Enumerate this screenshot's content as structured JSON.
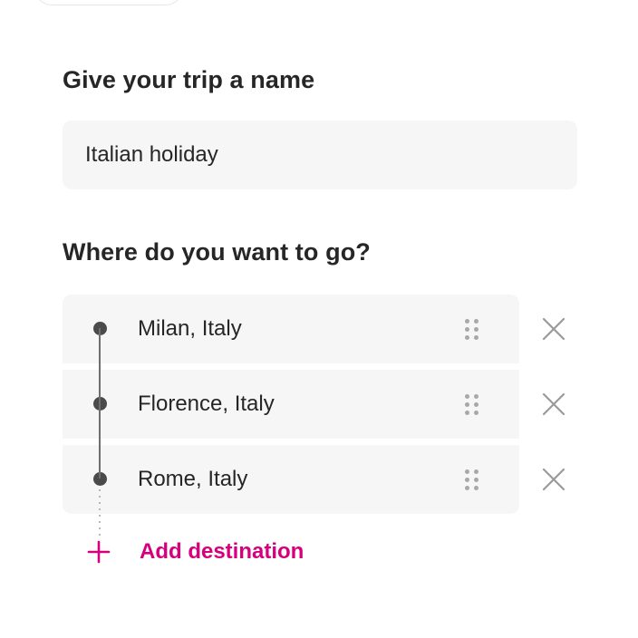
{
  "trip_name": {
    "heading": "Give your trip a name",
    "value": "Italian holiday"
  },
  "destinations": {
    "heading": "Where do you want to go?",
    "items": [
      {
        "label": "Milan, Italy"
      },
      {
        "label": "Florence, Italy"
      },
      {
        "label": "Rome, Italy"
      }
    ],
    "add_label": "Add destination"
  },
  "icons": {
    "drag": "drag-handle-icon",
    "remove": "close-icon",
    "add": "plus-icon",
    "stop": "timeline-dot-icon"
  },
  "colors": {
    "accent": "#d6007f",
    "field_bg": "#f6f6f6",
    "text": "#262626",
    "muted_icon": "#a8a8a8"
  }
}
